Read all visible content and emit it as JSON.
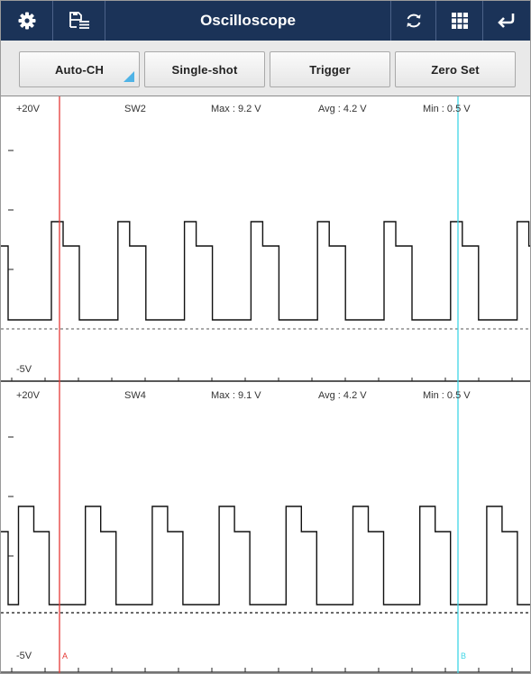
{
  "toolbar": {
    "title": "Oscilloscope",
    "icons": [
      "gear-icon",
      "save-list-icon",
      "refresh-icon",
      "grid-icon",
      "back-arrow-icon"
    ],
    "colors": {
      "bar": "#1b3358",
      "text": "#ffffff"
    }
  },
  "buttons": {
    "auto_ch": "Auto-CH",
    "single_shot": "Single-shot",
    "trigger": "Trigger",
    "zero_set": "Zero Set",
    "accent": "#4fb3e6"
  },
  "channels": [
    {
      "top_label": "+20V",
      "bottom_label": "-5V",
      "name": "SW2",
      "max": "Max : 9.2 V",
      "avg": "Avg : 4.2 V",
      "min": "Min : 0.5 V"
    },
    {
      "top_label": "+20V",
      "bottom_label": "-5V",
      "name": "SW4",
      "max": "Max : 9.1 V",
      "avg": "Avg : 4.2 V",
      "min": "Min : 0.5 V"
    }
  ],
  "cursors": {
    "a": {
      "label": "A",
      "color": "#e53935"
    },
    "b": {
      "label": "B",
      "color": "#3fd6e6"
    }
  }
}
